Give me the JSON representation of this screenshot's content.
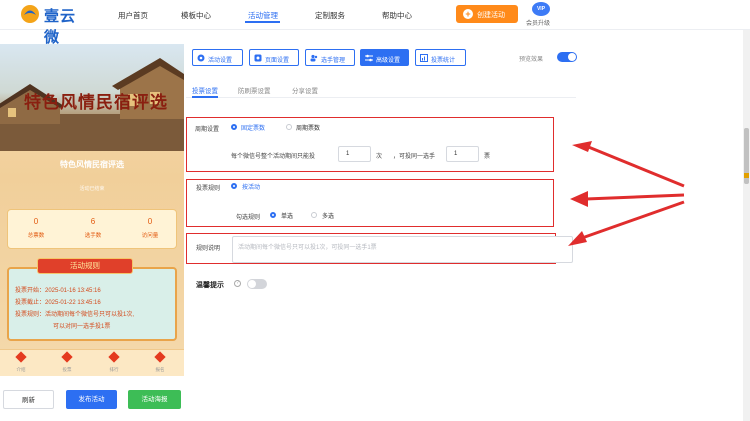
{
  "brand": {
    "name": "壹云微",
    "tagline": "壹云微"
  },
  "nav": {
    "items": [
      "用户首页",
      "模板中心",
      "活动管理",
      "定制服务",
      "帮助中心"
    ],
    "active_index": 2,
    "create_label": "创建活动",
    "vip_badge": "VIP",
    "vip_label": "会员升级"
  },
  "preview": {
    "banner_title": "特色风情民宿评选",
    "activity_name": "特色风情民宿评选",
    "activity_sub": "活动已结束",
    "stats": [
      {
        "value": "0",
        "label": "总票数"
      },
      {
        "value": "6",
        "label": "选手数"
      },
      {
        "value": "0",
        "label": "访问量"
      }
    ],
    "rules_title": "活动规则",
    "rules": [
      "投票开始：2025-01-16 13:45:16",
      "投票截止：2025-01-22 13:45:16",
      "投票规则：活动期间每个微信号只可以投1次,",
      "可以对同一选手投1票"
    ],
    "bottom_nav": [
      "介绍",
      "投票",
      "排行",
      "报名"
    ]
  },
  "left_buttons": {
    "refresh": "刷新",
    "publish": "发布活动",
    "poster": "活动海报"
  },
  "tabs": [
    {
      "label": "活动设置",
      "icon": "settings-icon"
    },
    {
      "label": "页面设置",
      "icon": "gear-icon"
    },
    {
      "label": "选手管理",
      "icon": "users-icon"
    },
    {
      "label": "高级设置",
      "icon": "sliders-icon"
    },
    {
      "label": "投票统计",
      "icon": "chart-icon"
    }
  ],
  "active_tab_index": 3,
  "preview_effect": {
    "label": "预览效果",
    "on": true
  },
  "subtabs": [
    "投票设置",
    "防刷票设置",
    "分享设置"
  ],
  "active_subtab_index": 0,
  "period": {
    "label": "周期设置",
    "options": [
      "固定票数",
      "周期票数"
    ],
    "selected": 0,
    "sentence": {
      "prefix": "每个微信号整个活动期间只能投",
      "votes": "1",
      "unit": "次",
      "middle": "，可投同一选手",
      "same_votes": "1",
      "suffix": "票"
    }
  },
  "rule": {
    "label": "投票规则",
    "options": [
      "按活动"
    ],
    "selected": 0,
    "check_label": "勾选规则",
    "check_options": [
      "单选",
      "多选"
    ],
    "check_selected": 0
  },
  "description": {
    "label": "规则说明",
    "placeholder": "活动期间每个微信号只可以投1次，可投同一选手1票"
  },
  "tip": {
    "label": "温馨提示",
    "on": false
  },
  "colors": {
    "primary": "#2d6ff2",
    "accent": "#ff8a1a",
    "highlight": "#e02d2d",
    "success": "#3dbd56"
  }
}
